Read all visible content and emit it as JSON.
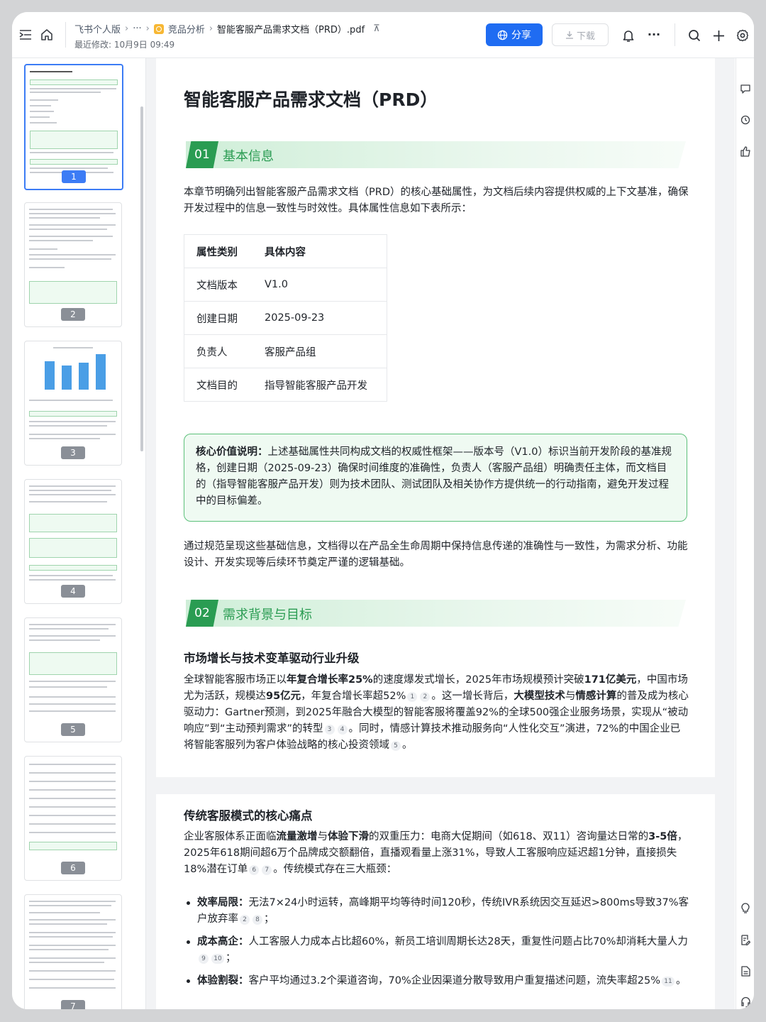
{
  "breadcrumb": {
    "root": "飞书个人版",
    "ellipsis": "···",
    "folder": "竞品分析",
    "file": "智能客服产品需求文档（PRD）.pdf",
    "pin_glyph": "⊼"
  },
  "modified": "最近修改: 10月9日 09:49",
  "toolbar": {
    "share_label": "分享",
    "download_label": "下载",
    "more_glyph": "···"
  },
  "thumbnails": [
    {
      "page": "1",
      "active": true
    },
    {
      "page": "2",
      "active": false
    },
    {
      "page": "3",
      "active": false
    },
    {
      "page": "4",
      "active": false
    },
    {
      "page": "5",
      "active": false
    },
    {
      "page": "6",
      "active": false
    },
    {
      "page": "7",
      "active": false
    }
  ],
  "doc": {
    "title": "智能客服产品需求文档（PRD）",
    "sec1": {
      "num": "01",
      "title": "基本信息"
    },
    "intro": "本章节明确列出智能客服产品需求文档（PRD）的核心基础属性，为文档后续内容提供权威的上下文基准，确保开发过程中的信息一致性与时效性。具体属性信息如下表所示：",
    "table": {
      "headers": [
        "属性类别",
        "具体内容"
      ],
      "rows": [
        [
          "文档版本",
          "V1.0"
        ],
        [
          "创建日期",
          "2025-09-23"
        ],
        [
          "负责人",
          "客服产品组"
        ],
        [
          "文档目的",
          "指导智能客服产品开发"
        ]
      ]
    },
    "callout": {
      "label": "核心价值说明：",
      "text": "上述基础属性共同构成文档的权威性框架——版本号（V1.0）标识当前开发阶段的基准规格，创建日期（2025-09-23）确保时间维度的准确性，负责人（客服产品组）明确责任主体，而文档目的（指导智能客服产品开发）则为技术团队、测试团队及相关协作方提供统一的行动指南，避免开发过程中的目标偏差。"
    },
    "para2": "通过规范呈现这些基础信息，文档得以在产品全生命周期中保持信息传递的准确性与一致性，为需求分析、功能设计、开发实现等后续环节奠定严谨的逻辑基础。",
    "sec2": {
      "num": "02",
      "title": "需求背景与目标"
    },
    "sub1": "市场增长与技术变革驱动行业升级",
    "market": {
      "t1": "全球智能客服市场正以",
      "b1": "年复合增长率25%",
      "t2": "的速度爆发式增长，2025年市场规模预计突破",
      "b2": "171亿美元",
      "t3": "，中国市场尤为活跃，规模达",
      "b3": "95亿元",
      "t4": "，年复合增长率超52%",
      "c1": "1",
      "c2": "2",
      "t5": "。这一增长背后，",
      "b4": "大模型技术",
      "t6": "与",
      "b5": "情感计算",
      "t7": "的普及成为核心驱动力：Gartner预测，到2025年融合大模型的智能客服将覆盖92%的全球500强企业服务场景，实现从“被动响应”到“主动预判需求”的转型",
      "c3": "3",
      "c4": "4",
      "t8": "。同时，情感计算技术推动服务向“人性化交互”演进，72%的中国企业已将智能客服列为客户体验战略的核心投资领域",
      "c5": "5",
      "t9": "。"
    },
    "sub2": "传统客服模式的核心痛点",
    "pain": {
      "t1": "企业客服体系正面临",
      "b1": "流量激增",
      "t2": "与",
      "b2": "体验下滑",
      "t3": "的双重压力：电商大促期间（如618、双11）咨询量达日常的",
      "b3": "3-5倍",
      "t4": "，2025年618期间超6万个品牌成交额翻倍，直播观看量上涨31%，导致人工客服响应延迟超1分钟，直接损失18%潜在订单",
      "c1": "6",
      "c2": "7",
      "t5": "。传统模式存在三大瓶颈："
    },
    "bullets": [
      {
        "label": "效率局限：",
        "text": "无法7×24小时运转，高峰期平均等待时间120秒，传统IVR系统因交互延迟>800ms导致37%客户放弃率",
        "c1": "2",
        "c2": "8",
        "end": "；"
      },
      {
        "label": "成本高企：",
        "text": "人工客服人力成本占比超60%，新员工培训周期长达28天，重复性问题占比70%却消耗大量人力",
        "c1": "9",
        "c2": "10",
        "end": "；"
      },
      {
        "label": "体验割裂：",
        "text": "客户平均通过3.2个渠道咨询，70%企业因渠道分散导致用户重复描述问题，流失率超25%",
        "c1": "11",
        "c2": "",
        "end": "。"
      }
    ]
  }
}
